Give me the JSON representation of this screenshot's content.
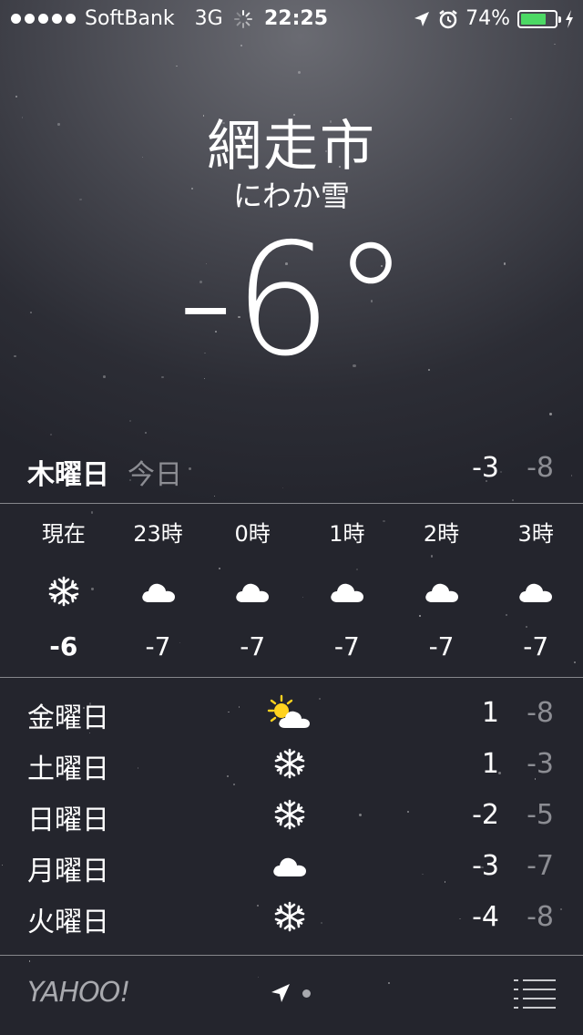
{
  "status_bar": {
    "carrier": "SoftBank",
    "network": "3G",
    "time": "22:25",
    "battery_percent": "74%",
    "battery_level": 0.74,
    "battery_color": "#4cd964",
    "icons": [
      "signal-dots-icon",
      "activity-spinner-icon",
      "location-arrow-icon",
      "alarm-clock-icon",
      "battery-icon",
      "charging-bolt-icon"
    ]
  },
  "weather": {
    "city": "網走市",
    "condition": "にわか雪",
    "current_temp": "-6°"
  },
  "today": {
    "day": "木曜日",
    "label": "今日",
    "high": "-3",
    "low": "-8"
  },
  "hourly": [
    {
      "time": "現在",
      "icon": "snowflake-icon",
      "temp": "-6"
    },
    {
      "time": "23時",
      "icon": "cloud-icon",
      "temp": "-7"
    },
    {
      "time": "0時",
      "icon": "cloud-icon",
      "temp": "-7"
    },
    {
      "time": "1時",
      "icon": "cloud-icon",
      "temp": "-7"
    },
    {
      "time": "2時",
      "icon": "cloud-icon",
      "temp": "-7"
    },
    {
      "time": "3時",
      "icon": "cloud-icon",
      "temp": "-7"
    }
  ],
  "daily": [
    {
      "day": "金曜日",
      "icon": "partly-sunny-icon",
      "high": "1",
      "low": "-8"
    },
    {
      "day": "土曜日",
      "icon": "snowflake-icon",
      "high": "1",
      "low": "-3"
    },
    {
      "day": "日曜日",
      "icon": "snowflake-icon",
      "high": "-2",
      "low": "-5"
    },
    {
      "day": "月曜日",
      "icon": "cloud-icon",
      "high": "-3",
      "low": "-7"
    },
    {
      "day": "火曜日",
      "icon": "snowflake-icon",
      "high": "-4",
      "low": "-8"
    }
  ],
  "footer": {
    "logo": "YAHOO!",
    "icons": [
      "location-arrow-icon",
      "page-dot-icon",
      "list-icon"
    ]
  }
}
